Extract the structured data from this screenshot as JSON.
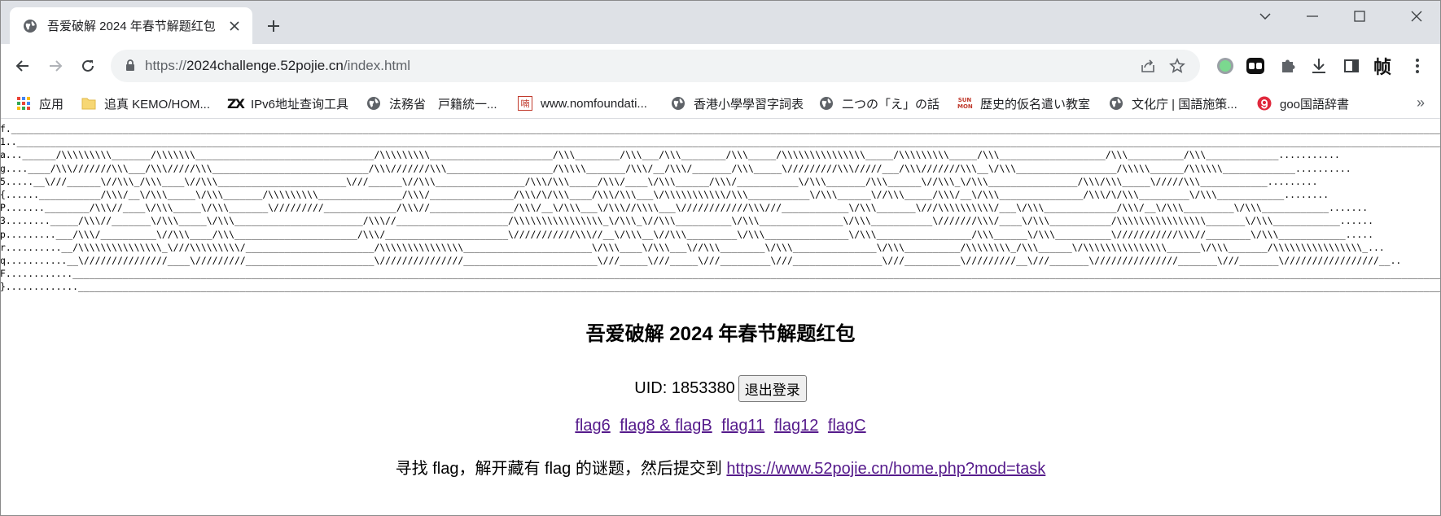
{
  "browser": {
    "tab": {
      "title": "吾爱破解 2024 年春节解题红包",
      "close_glyph": "✕"
    },
    "new_tab_glyph": "+",
    "window_controls": {
      "minimize": "—",
      "maximize": "☐",
      "close": "✕"
    },
    "address": {
      "scheme": "https://",
      "host": "2024challenge.52pojie.cn",
      "path": "/index.html"
    },
    "ext_letter": "帧"
  },
  "bookmarks": [
    {
      "label": "应用",
      "icon": "apps-grid-icon"
    },
    {
      "label": "追真 KEMO/HOM...",
      "icon": "folder-icon"
    },
    {
      "label": "IPv6地址查询工具",
      "icon": "zx-logo-icon",
      "icon_text": "ZX"
    },
    {
      "label": "法務省　戸籍統一...",
      "icon": "globe-icon"
    },
    {
      "label": "www.nomfoundati...",
      "icon": "nom-foundation-icon",
      "icon_text": "喃"
    },
    {
      "label": "香港小學學習字詞表",
      "icon": "globe-icon"
    },
    {
      "label": "二つの「え」の話",
      "icon": "globe-icon"
    },
    {
      "label": "歴史的仮名遣い教室",
      "icon": "sun-mon-icon",
      "icon_text": "SUN MON"
    },
    {
      "label": "文化庁 | 国語施策...",
      "icon": "globe-icon"
    },
    {
      "label": "goo国語辞書",
      "icon": "goo-icon"
    }
  ],
  "bookmarks_more": "»",
  "page": {
    "banner_lines": [
      "f.______________________________________________________________________________________________________________________________________________________________________________________________________________________________________________________________________.............",
      "1..______________________________________________________________________________________________________________________________________________________________________________________________________________________________________________________________________............",
      "a...______/\\\\\\\\\\\\\\\\\\_______/\\\\\\\\\\\\\\________________________________/\\\\\\\\\\\\\\\\\\______________________/\\\\\\________/\\\\\\___/\\\\\\________/\\\\\\_____/\\\\\\\\\\\\\\\\\\\\\\\\\\\\\\_____/\\\\\\\\\\\\\\\\\\_____/\\\\\\___________________/\\\\\\__________/\\\\\\_____________...........",
      "g....____/\\\\\\///////\\\\\\___/\\\\\\/////\\\\\\____________________________/\\\\\\///////\\\\\\___________________/\\\\\\\\\\_______/\\\\\\/__/\\\\\\/_______/\\\\\\_____\\/////////\\\\\\/////___/\\\\\\///////\\\\\\__\\/\\\\\\__________________/\\\\\\\\\\______/\\\\\\\\\\\\_____________..........",
      "5.....__\\///______\\//\\\\\\_/\\\\\\____\\//\\\\\\_______________________\\///______\\//\\\\\\________________/\\\\\\/\\\\\\_____/\\\\\\/____\\/\\\\\\______/\\\\\\/___________\\/\\\\\\_______/\\\\\\______\\//\\\\\\_\\/\\\\\\________________/\\\\\\/\\\\\\_____\\/////\\\\\\____________.........",
      "{......___________/\\\\\\/__\\/\\\\\\_____\\/\\\\\\_______/\\\\\\\\\\\\\\\\\\_______________/\\\\\\/_______________/\\\\\\/\\/\\\\\\____/\\\\\\/\\\\\\___\\/\\\\\\\\\\\\\\\\\\\\\\/\\\\\\___________\\/\\\\\\______\\//\\\\\\_____/\\\\\\/__\\/\\\\\\_______________/\\\\\\/\\/\\\\\\_________\\/\\\\\\____________........",
      "P.......________/\\\\\\//____\\/\\\\\\_____\\/\\\\\\_______\\/////////_____________/\\\\\\//_______________/\\\\\\/__\\/\\\\\\___\\/\\\\\\//\\\\\\\\___\\////////////\\\\\\///____________\\/\\\\\\_______\\///\\\\\\\\\\\\\\\\\\\\/___\\/\\\\\\_____________/\\\\\\/__\\/\\\\\\_________\\/\\\\\\____________.......",
      "3........_____/\\\\\\//_______\\/\\\\\\_____\\/\\\\\\_______________________/\\\\\\//____________________/\\\\\\\\\\\\\\\\\\\\\\\\\\\\\\\\_\\/\\\\\\_\\//\\\\\\__________\\/\\\\\\_______________\\/\\\\\\___________\\///////\\\\\\/____\\/\\\\\\___________/\\\\\\\\\\\\\\\\\\\\\\\\\\\\\\\\_______\\/\\\\\\____________......",
      "p.........___/\\\\\\/__________\\//\\\\\\____/\\\\\\______________________/\\\\\\/______________________\\///////////\\\\\\//__\\/\\\\\\__\\//\\\\\\_________\\/\\\\\\_______________\\/\\\\\\_________________/\\\\\\______\\/\\\\\\__________\\///////////\\\\\\//________\\/\\\\\\____________.....",
      "r..........__/\\\\\\\\\\\\\\\\\\\\\\\\\\\\\\_\\///\\\\\\\\\\\\\\\\\\/_______________________/\\\\\\\\\\\\\\\\\\\\\\\\\\\\\\_______________________\\/\\\\\\____\\/\\\\\\___\\//\\\\\\________\\/\\\\\\_______________\\/\\\\\\__________/\\\\\\\\\\\\\\\\_/\\\\\\______\\/\\\\\\\\\\\\\\\\\\\\\\\\\\\\\\______\\/\\\\\\_______/\\\\\\\\\\\\\\\\\\\\\\\\\\\\\\\\_...",
      "q...........__\\///////////////____\\/////////_______________________\\///////////////________________________\\///_____\\///_____\\///_________\\///________________\\///__________\\/////////__\\///_______\\///////////////_______\\///_______\\/////////////////__..",
      "F............______________________________________________________________________________________________________________________________________________________________________________________________________________________________________________________________________.",
      "}.............______________________________________________________________________________________________________________________________________________________________________________________________________________________________________________________________________"
    ],
    "heading": "吾爱破解 2024 年春节解题红包",
    "uid_label": "UID: 1853380",
    "logout_label": "退出登录",
    "flag_links": [
      "flag6",
      "flag8 & flagB",
      "flag11",
      "flag12",
      "flagC"
    ],
    "task_text": "寻找 flag，解开藏有 flag 的谜题，然后提交到",
    "task_link": "https://www.52pojie.cn/home.php?mod=task"
  }
}
